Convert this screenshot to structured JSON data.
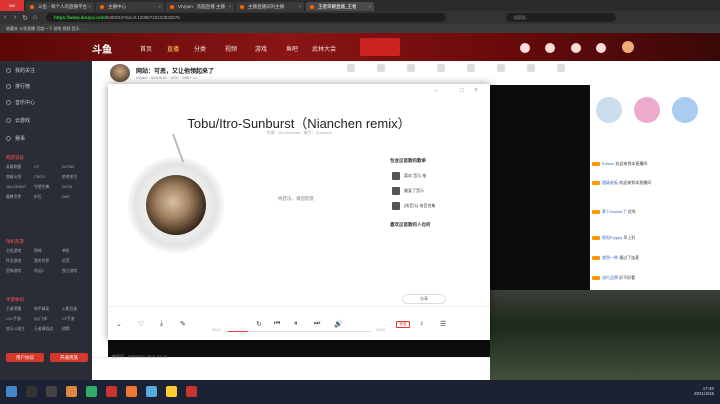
{
  "browser": {
    "tabs": [
      "斗鱼 - 每个人的直播平台",
      "主播中心",
      "VIVpen · 洗脑直播 主播",
      "主播直播间的主播",
      "王者荣耀直播_王者"
    ],
    "url_host": "https://www.douyu.com/",
    "url_path": "5280010?rid=0.12086743102832876",
    "search_placeholder": "搜索框",
    "bookmarks": "收藏夹  斗鱼直播  百度一下  游戏  视频  音乐  ..."
  },
  "douyu": {
    "logo": "斗鱼",
    "nav": [
      "首页",
      "直播",
      "分类",
      "视频",
      "游戏",
      "鱼吧",
      "武林大会"
    ],
    "room_title": "网站：可恶，又让他领起来了",
    "room_sub": "vVpen · 5280010 · 1257 · 999+ Lv"
  },
  "sidebar": {
    "top": [
      "我的关注",
      "排行榜",
      "音乐中心",
      "云游戏",
      "赛事"
    ],
    "sections": [
      {
        "title": "网游竞技",
        "items": [
          "英雄联盟",
          "CF",
          "穿越火线",
          "DOTA2",
          "CSGO",
          "绝地求生",
          "VALORANT",
          "守望先锋",
          "DOTA",
          "魔兽世界",
          "炉石",
          "DNF"
        ]
      },
      {
        "title": "单机热游",
        "items": [
          "主机游戏",
          "原神",
          "单机",
          "怀旧游戏",
          "我的世界",
          "饥荒",
          "恐怖游戏",
          "命运2",
          "独立游戏"
        ]
      },
      {
        "title": "手游休闲",
        "items": [
          "王者荣耀",
          "和平精英",
          "火影忍者",
          "LOL手游",
          "QQ飞车",
          "CF手游",
          "欢乐斗地主",
          "王者模拟战",
          "棋牌"
        ]
      }
    ],
    "btn_left": "用户协议",
    "btn_right": "开通贵族"
  },
  "player": {
    "title": "Tobu/Itro-Sunburst（Nianchen remix）",
    "subtitle": "专辑：Wi-Sunburst · 歌手：Sunburst",
    "no_lyric": "纯音乐，请您欣赏",
    "similar_title": "包含这首歌的歌单",
    "similar": [
      "喜欢 音乐 推",
      "最爱了音乐",
      "[纯音乐] 电音合集"
    ],
    "also_title": "喜欢这首歌的人也听",
    "share": "分享",
    "time_left": "00:12",
    "time_right": "03:23",
    "tag": "标准"
  },
  "chat": [
    {
      "name": "Edison",
      "text": "欢迎来到本直播间"
    },
    {
      "name": "超级老板",
      "text": "欢迎来到本直播间"
    },
    {
      "name": "萝卜Double了",
      "text": "优秀"
    },
    {
      "name": "欧阳Fryppy",
      "text": "早上好"
    },
    {
      "name": "咸鱼一种",
      "text": "通过了连麦"
    },
    {
      "name": "流行品牌",
      "text": "好不好看"
    },
    {
      "name": "星空",
      "text": "哈哈哈哈"
    }
  ],
  "footer": {
    "room_id": "房间号：5280010 | 2021.03.16"
  },
  "taskbar": {
    "time": "17:40",
    "date": "2021/3/16"
  }
}
